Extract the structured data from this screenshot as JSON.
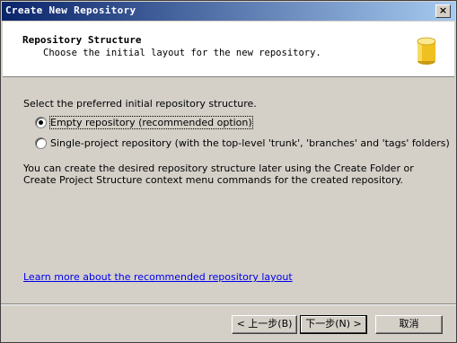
{
  "window": {
    "title": "Create New Repository",
    "close_glyph": "×"
  },
  "header": {
    "title": "Repository Structure",
    "subtitle": "Choose the initial layout for the new repository.",
    "icon": "database-icon"
  },
  "body": {
    "intro": "Select the preferred initial repository structure.",
    "options": [
      {
        "label": "Empty repository (recommended option)",
        "checked": true
      },
      {
        "label": "Single-project repository (with the top-level 'trunk', 'branches' and 'tags' folders)",
        "checked": false
      }
    ],
    "description": "You can create the desired repository structure later using the Create Folder or Create Project Structure context menu commands for the created repository.",
    "link": "Learn more about the recommended repository layout"
  },
  "buttons": {
    "back": "< 上一步(B)",
    "next": "下一步(N) >",
    "cancel": "取消"
  },
  "colors": {
    "title_start": "#0a246a",
    "title_end": "#a6caf0",
    "link": "#0000ee",
    "icon": "#f0c020"
  }
}
